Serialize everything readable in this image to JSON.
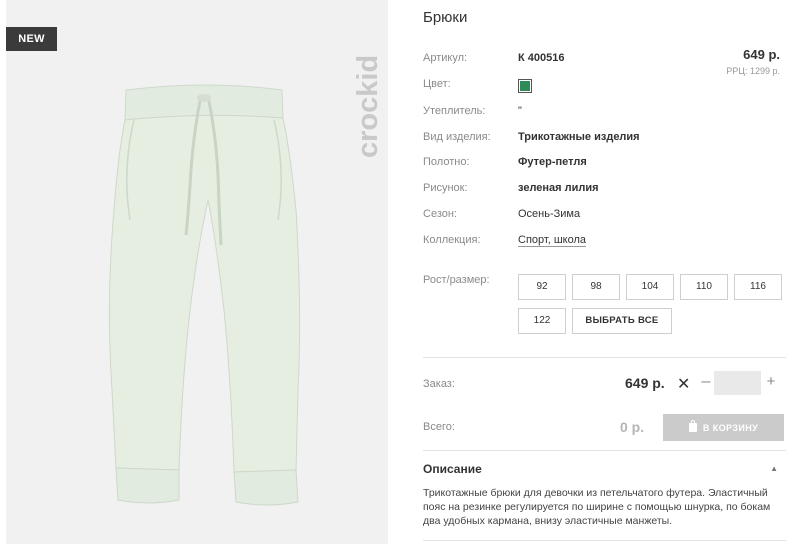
{
  "badge": {
    "new": "NEW"
  },
  "brand": {
    "logo_text": "crockid"
  },
  "product": {
    "title": "Брюки",
    "price": "649 р.",
    "rrp": "РРЦ: 1299 р.",
    "color_hex": "#2e8b57",
    "attributes": [
      {
        "label": "Артикул:",
        "value": "К 400516"
      },
      {
        "label": "Цвет:",
        "value": ""
      },
      {
        "label": "Утеплитель:",
        "value": "\""
      },
      {
        "label": "Вид изделия:",
        "value": "Трикотажные изделия"
      },
      {
        "label": "Полотно:",
        "value": "Футер-петля"
      },
      {
        "label": "Рисунок:",
        "value": "зеленая лилия"
      },
      {
        "label": "Сезон:",
        "value": "Осень-Зима"
      },
      {
        "label": "Коллекция:",
        "value": "Спорт, школа"
      }
    ]
  },
  "sizes": {
    "label": "Рост/размер:",
    "options": [
      "92",
      "98",
      "104",
      "110",
      "116",
      "122"
    ],
    "select_all": "ВЫБРАТЬ ВСЕ"
  },
  "order": {
    "label": "Заказ:",
    "price": "649 р.",
    "times": "✕",
    "minus": "–",
    "plus": "+",
    "qty": ""
  },
  "total": {
    "label": "Всего:",
    "value": "0 р.",
    "cart_button": "В КОРЗИНУ"
  },
  "description": {
    "title": "Описание",
    "toggle": "▲",
    "text": "Трикотажные брюки для девочки из петельчатого футера. Эластичный пояс на резинке регулируется по ширине с помощью шнурка, по бокам два удобных кармана, внизу эластичные манжеты."
  }
}
